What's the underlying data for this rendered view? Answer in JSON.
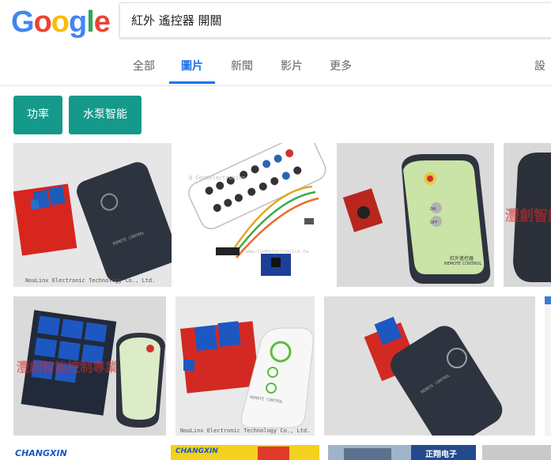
{
  "logo": {
    "letters": [
      "G",
      "o",
      "o",
      "g",
      "l",
      "e"
    ],
    "colors": [
      "#4285F4",
      "#EA4335",
      "#FBBC05",
      "#4285F4",
      "#34A853",
      "#EA4335"
    ]
  },
  "search": {
    "query": "紅外 遙控器 開關"
  },
  "tabs": [
    {
      "label": "全部",
      "active": false
    },
    {
      "label": "圖片",
      "active": true
    },
    {
      "label": "新聞",
      "active": false
    },
    {
      "label": "影片",
      "active": false
    },
    {
      "label": "更多",
      "active": false
    },
    {
      "label": "設定",
      "active": false
    }
  ],
  "chips": [
    {
      "label": "功率"
    },
    {
      "label": "水泵智能"
    }
  ],
  "accent_color": "#14998a",
  "results": {
    "row1": [
      {
        "caption": "NouLinx Electronic Technology Co., Ltd.",
        "remote_label": "REMOTE CONTROL"
      },
      {
        "caption": "@ CooKelectronics",
        "caption2": "www.CooKelectronics.tw"
      },
      {
        "remote_label": "紅外遙控器",
        "remote_label2": "REMOTE CONTROL",
        "btn_a": "ON",
        "btn_b": "OFF"
      },
      {
        "watermark": "灃創智能"
      }
    ],
    "row2": [
      {
        "watermark": "灃創智能控制專業"
      },
      {
        "caption": "NouLinx Electronic Technology Co., Ltd.",
        "remote_label": "REMOTE CONTROL"
      },
      {
        "remote_label": "REMOTE CONTROL"
      },
      {}
    ],
    "row3": [
      {
        "brand": "CHANGXIN"
      },
      {
        "brand": "CHANGXIN"
      },
      {},
      {
        "brand": "正翔电子"
      },
      {}
    ]
  }
}
